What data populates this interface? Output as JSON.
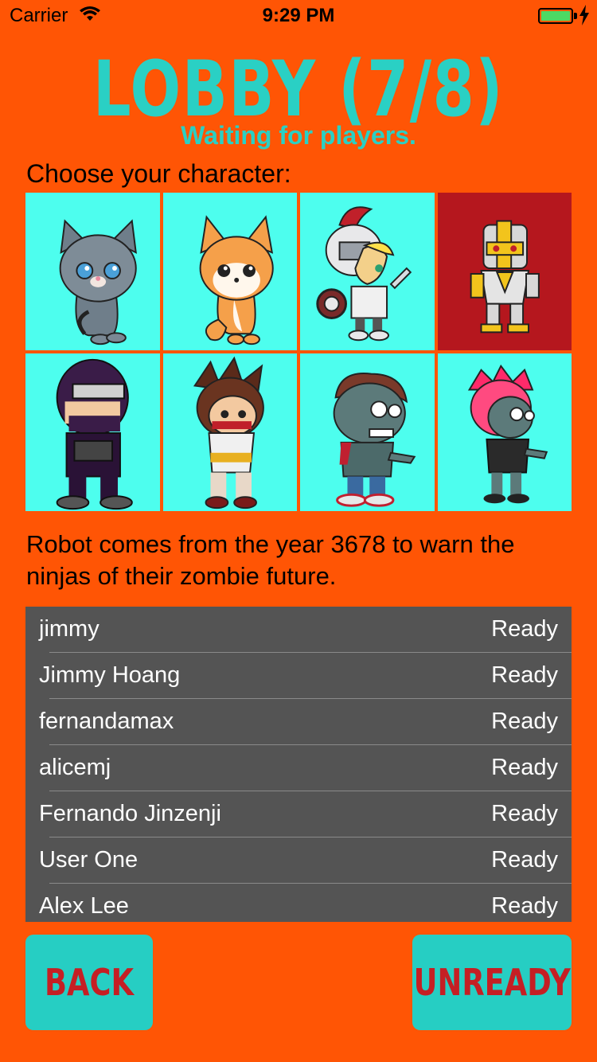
{
  "status_bar": {
    "carrier": "Carrier",
    "time": "9:29 PM"
  },
  "header": {
    "title": "LOBBY (7/8)",
    "subtitle": "Waiting for players."
  },
  "choose_label": "Choose your character:",
  "characters": [
    {
      "name": "gray-cat",
      "selected": false
    },
    {
      "name": "orange-fox",
      "selected": false
    },
    {
      "name": "knight",
      "selected": false
    },
    {
      "name": "robot",
      "selected": true
    },
    {
      "name": "ninja",
      "selected": false
    },
    {
      "name": "kunoichi",
      "selected": false
    },
    {
      "name": "zombie-boy",
      "selected": false
    },
    {
      "name": "zombie-girl",
      "selected": false
    }
  ],
  "description": "Robot comes from the year 3678 to warn the ninjas of their zombie future.",
  "players": [
    {
      "name": "jimmy",
      "status": "Ready"
    },
    {
      "name": "Jimmy Hoang",
      "status": "Ready"
    },
    {
      "name": "fernandamax",
      "status": "Ready"
    },
    {
      "name": "alicemj",
      "status": "Ready"
    },
    {
      "name": "Fernando Jinzenji",
      "status": "Ready"
    },
    {
      "name": "User One",
      "status": "Ready"
    },
    {
      "name": "Alex Lee",
      "status": "Ready"
    }
  ],
  "buttons": {
    "back": "BACK",
    "unready": "UNREADY"
  },
  "colors": {
    "background": "#ff5505",
    "accent": "#2ad0c4",
    "cell": "#4dfeee",
    "selected_cell": "#b5171e",
    "list_bg": "#545454",
    "button_text": "#c51f24"
  }
}
